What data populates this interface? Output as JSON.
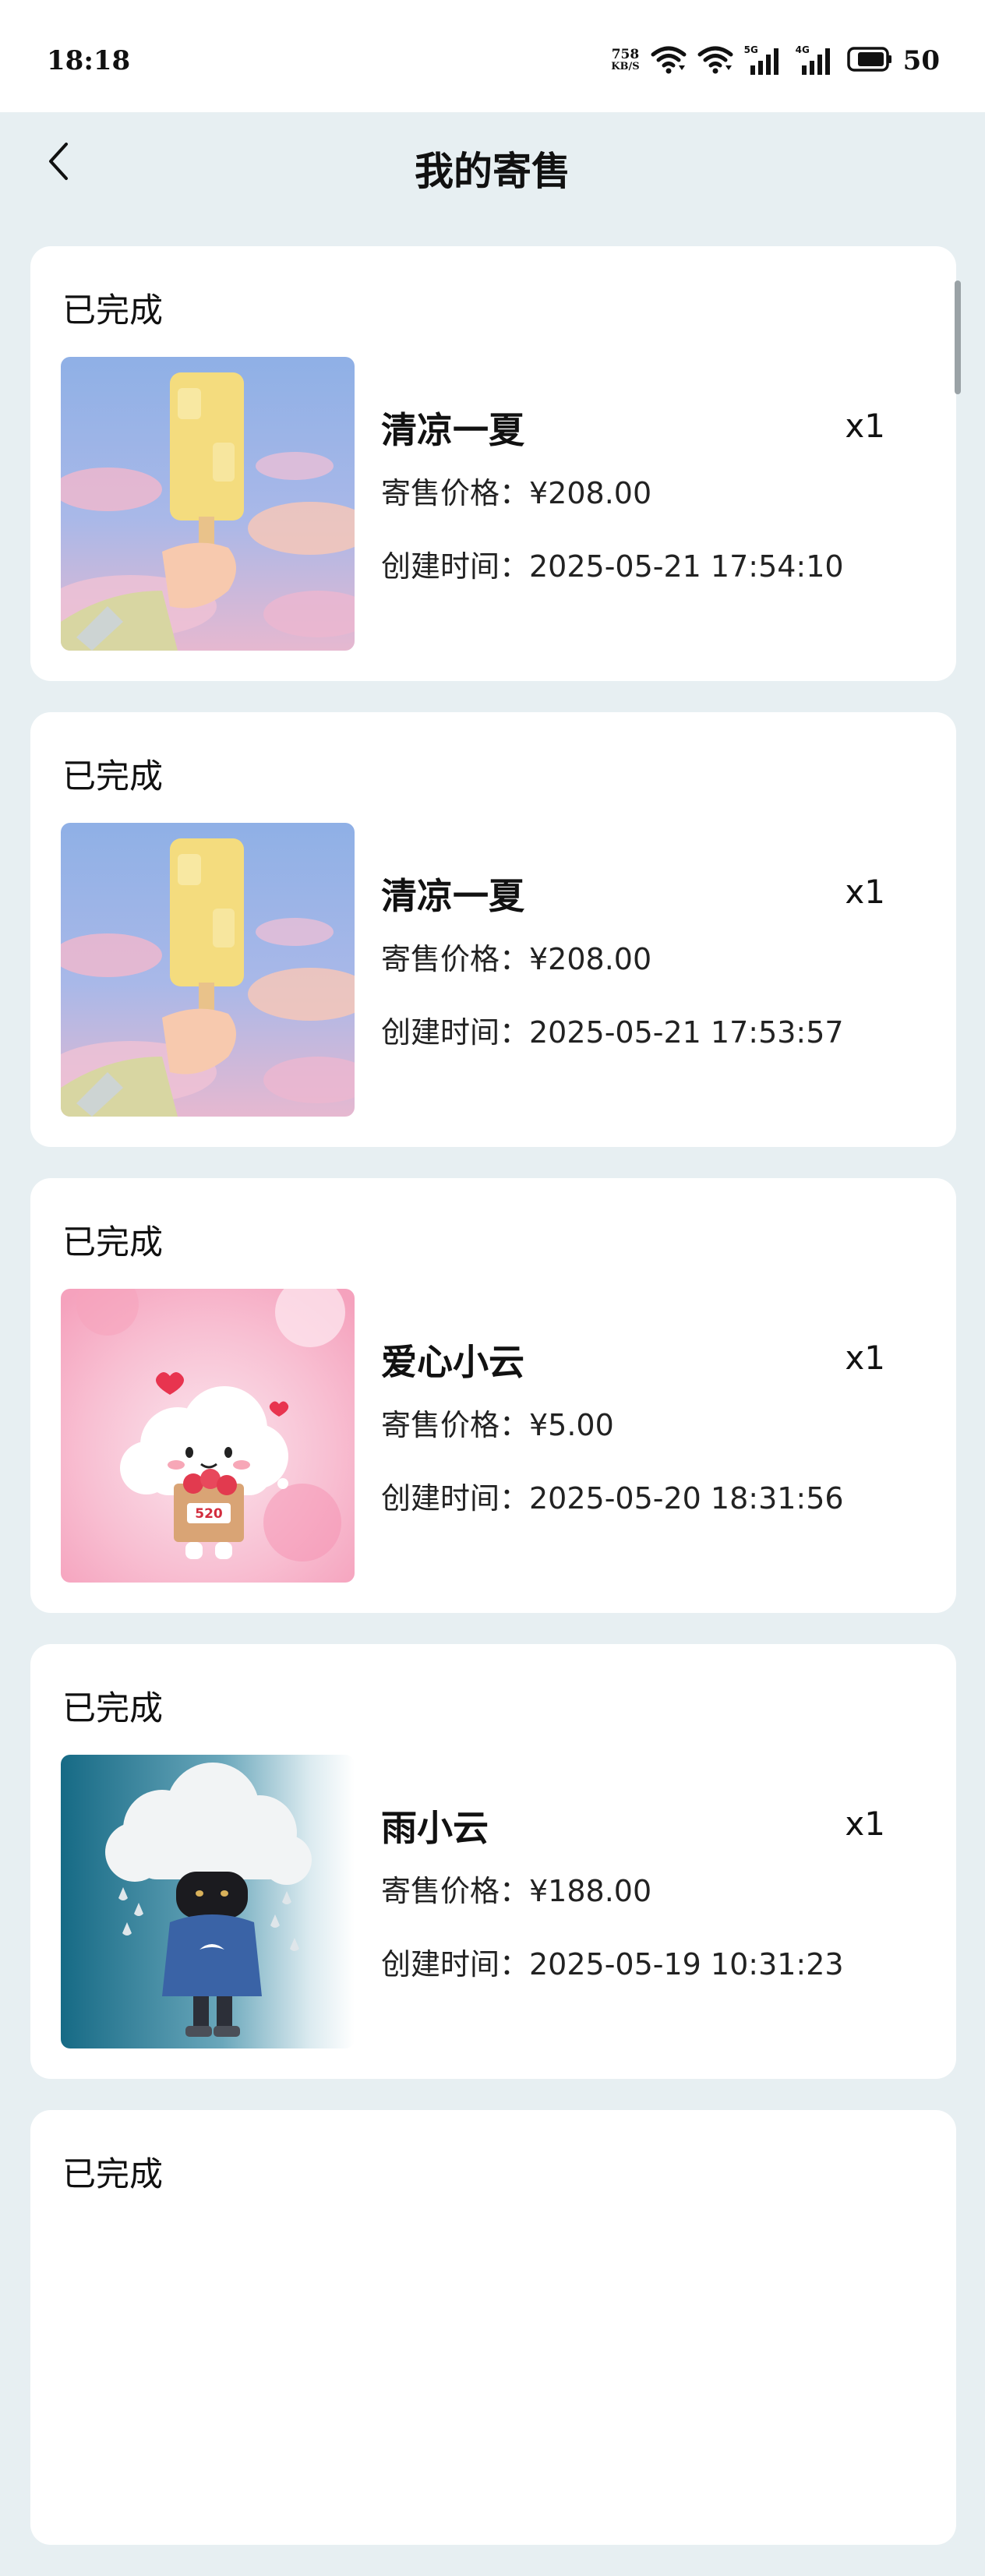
{
  "status_bar": {
    "time": "18:18",
    "net_speed_value": "758",
    "net_speed_unit": "KB/S",
    "sim1_label": "5G",
    "sim2_label": "4G",
    "battery_level": "50"
  },
  "header": {
    "title": "我的寄售",
    "back_icon": "chevron-left-icon"
  },
  "orders": [
    {
      "status": "已完成",
      "name": "清凉一夏",
      "quantity": "x1",
      "price": "寄售价格：¥208.00",
      "created": "创建时间：2025-05-21 17:54:10",
      "image": "popsicle-illustration"
    },
    {
      "status": "已完成",
      "name": "清凉一夏",
      "quantity": "x1",
      "price": "寄售价格：¥208.00",
      "created": "创建时间：2025-05-21 17:53:57",
      "image": "popsicle-illustration"
    },
    {
      "status": "已完成",
      "name": "爱心小云",
      "quantity": "x1",
      "price": "寄售价格：¥5.00",
      "created": "创建时间：2025-05-20 18:31:56",
      "image": "heart-cloud-illustration",
      "image_text": "520"
    },
    {
      "status": "已完成",
      "name": "雨小云",
      "quantity": "x1",
      "price": "寄售价格：¥188.00",
      "created": "创建时间：2025-05-19 10:31:23",
      "image": "rain-cloud-illustration"
    },
    {
      "status": "已完成"
    }
  ],
  "colors": {
    "page_background": "#e7eff2",
    "card_background": "#ffffff",
    "text": "#111111"
  }
}
